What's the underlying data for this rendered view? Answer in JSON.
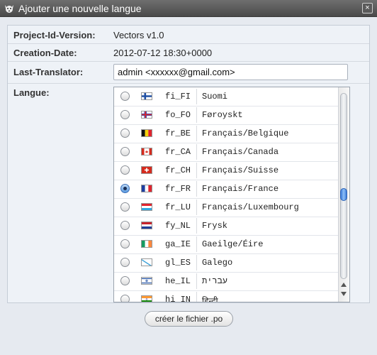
{
  "window": {
    "title": "Ajouter une nouvelle langue",
    "close_label": "×",
    "app_icon": "gnu-head-icon",
    "close_icon": "close-icon"
  },
  "form": {
    "project_label": "Project-Id-Version:",
    "project_value": "Vectors v1.0",
    "date_label": "Creation-Date:",
    "date_value": "2012-07-12 18:30+0000",
    "translator_label": "Last-Translator:",
    "translator_value": "admin <xxxxxx@gmail.com>",
    "langue_label": "Langue:"
  },
  "languages": [
    {
      "code": "fi_FI",
      "name": "Suomi",
      "flag": "flag-finland-icon",
      "selected": false
    },
    {
      "code": "fo_FO",
      "name": "Føroyskt",
      "flag": "flag-faroe-icon",
      "selected": false
    },
    {
      "code": "fr_BE",
      "name": "Français/Belgique",
      "flag": "flag-belgium-icon",
      "selected": false
    },
    {
      "code": "fr_CA",
      "name": "Français/Canada",
      "flag": "flag-canada-icon",
      "selected": false
    },
    {
      "code": "fr_CH",
      "name": "Français/Suisse",
      "flag": "flag-switzerland-icon",
      "selected": false
    },
    {
      "code": "fr_FR",
      "name": "Français/France",
      "flag": "flag-france-icon",
      "selected": true
    },
    {
      "code": "fr_LU",
      "name": "Français/Luxembourg",
      "flag": "flag-luxembourg-icon",
      "selected": false
    },
    {
      "code": "fy_NL",
      "name": "Frysk",
      "flag": "flag-netherlands-icon",
      "selected": false
    },
    {
      "code": "ga_IE",
      "name": "Gaeilge/Éire",
      "flag": "flag-ireland-icon",
      "selected": false
    },
    {
      "code": "gl_ES",
      "name": "Galego",
      "flag": "flag-galicia-icon",
      "selected": false
    },
    {
      "code": "he_IL",
      "name": "עברית",
      "flag": "flag-israel-icon",
      "selected": false
    },
    {
      "code": "hi_IN",
      "name": "हिन्दी",
      "flag": "flag-india-icon",
      "selected": false
    }
  ],
  "create_button": "créer le fichier .po",
  "colors": {
    "title_bar": "#555555",
    "panel": "#eef2f7",
    "selected_radio": "#5b9be0",
    "scroll_thumb": "#3c7bd9"
  }
}
